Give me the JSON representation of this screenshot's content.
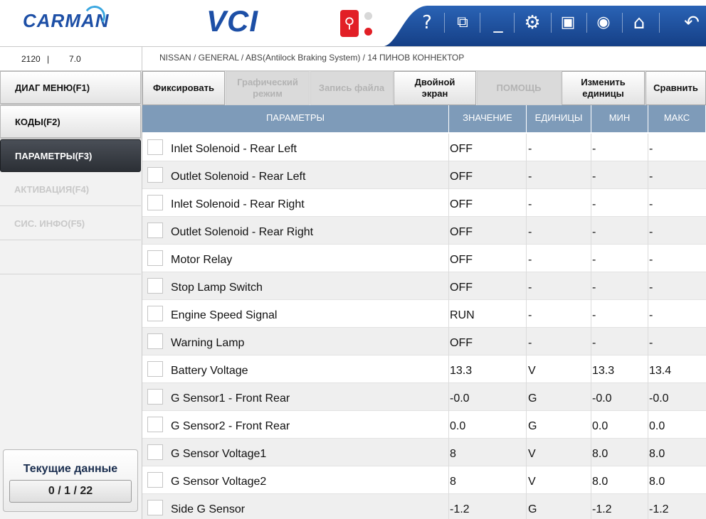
{
  "header": {
    "brand": "CARMAN",
    "product": "VCI",
    "icons": [
      "help-icon",
      "window-restore-icon",
      "minimize-icon",
      "settings-icon",
      "save-icon",
      "camera-icon",
      "home-icon",
      "back-icon"
    ],
    "accent_color": "#1d4fa6",
    "toolbar_color": "#1f4f9c"
  },
  "info": {
    "code": "2120",
    "separator": "|",
    "version": "7.0",
    "breadcrumb": "NISSAN / GENERAL / ABS(Antilock Braking System) / 14 ПИНОВ КОННЕКТОР"
  },
  "sidebar": {
    "items": [
      {
        "label": "ДИАГ МЕНЮ(F1)",
        "state": "raised"
      },
      {
        "label": "КОДЫ(F2)",
        "state": "raised"
      },
      {
        "label": "ПАРАМЕТРЫ(F3)",
        "state": "active"
      },
      {
        "label": "АКТИВАЦИЯ(F4)",
        "state": "disabled"
      },
      {
        "label": "СИС. ИНФО(F5)",
        "state": "disabled"
      },
      {
        "label": "",
        "state": "empty"
      }
    ],
    "current": {
      "title": "Текущие данные",
      "count": "0 / 1 / 22"
    }
  },
  "toolbar": {
    "buttons": [
      {
        "line1": "Фиксировать",
        "line2": "",
        "enabled": true
      },
      {
        "line1": "Графический",
        "line2": "режим",
        "enabled": false
      },
      {
        "line1": "Запись файла",
        "line2": "",
        "enabled": false
      },
      {
        "line1": "Двойной",
        "line2": "экран",
        "enabled": true
      },
      {
        "line1": "ПОМОЩЬ",
        "line2": "",
        "enabled": false
      },
      {
        "line1": "Изменить",
        "line2": "единицы",
        "enabled": true
      },
      {
        "line1": "Сравнить",
        "line2": "",
        "enabled": true
      }
    ]
  },
  "table": {
    "columns": [
      "ПАРАМЕТРЫ",
      "ЗНАЧЕНИЕ",
      "ЕДИНИЦЫ",
      "МИН",
      "МАКС"
    ],
    "rows": [
      {
        "name": "Inlet Solenoid - Rear Left",
        "value": "OFF",
        "unit": "-",
        "min": "-",
        "max": "-"
      },
      {
        "name": "Outlet Solenoid - Rear Left",
        "value": "OFF",
        "unit": "-",
        "min": "-",
        "max": "-"
      },
      {
        "name": "Inlet Solenoid - Rear Right",
        "value": "OFF",
        "unit": "-",
        "min": "-",
        "max": "-"
      },
      {
        "name": "Outlet Solenoid - Rear Right",
        "value": "OFF",
        "unit": "-",
        "min": "-",
        "max": "-"
      },
      {
        "name": "Motor Relay",
        "value": "OFF",
        "unit": "-",
        "min": "-",
        "max": "-"
      },
      {
        "name": "Stop Lamp Switch",
        "value": "OFF",
        "unit": "-",
        "min": "-",
        "max": "-"
      },
      {
        "name": "Engine Speed Signal",
        "value": "RUN",
        "unit": "-",
        "min": "-",
        "max": "-"
      },
      {
        "name": "Warning Lamp",
        "value": "OFF",
        "unit": "-",
        "min": "-",
        "max": "-"
      },
      {
        "name": "Battery Voltage",
        "value": "13.3",
        "unit": "V",
        "min": "13.3",
        "max": "13.4"
      },
      {
        "name": "G Sensor1 - Front Rear",
        "value": "-0.0",
        "unit": "G",
        "min": "-0.0",
        "max": "-0.0"
      },
      {
        "name": "G Sensor2 - Front Rear",
        "value": "0.0",
        "unit": "G",
        "min": "0.0",
        "max": "0.0"
      },
      {
        "name": "G Sensor Voltage1",
        "value": "8",
        "unit": "V",
        "min": "8.0",
        "max": "8.0"
      },
      {
        "name": "G Sensor Voltage2",
        "value": "8",
        "unit": "V",
        "min": "8.0",
        "max": "8.0"
      },
      {
        "name": "Side G Sensor",
        "value": "-1.2",
        "unit": "G",
        "min": "-1.2",
        "max": "-1.2"
      }
    ]
  }
}
